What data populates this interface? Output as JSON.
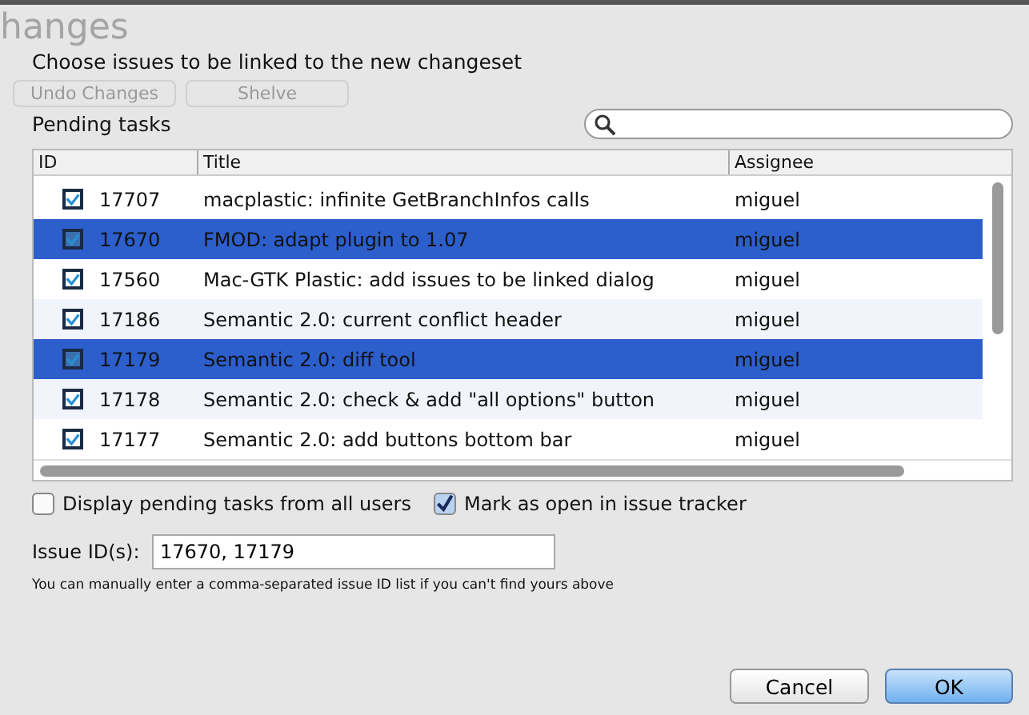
{
  "background": {
    "title": "hanges",
    "buttons": [
      "Undo Changes",
      "Shelve"
    ]
  },
  "dialog": {
    "heading": "Choose issues to be linked to the new changeset",
    "section_label": "Pending tasks"
  },
  "table": {
    "columns": [
      "ID",
      "Title",
      "Assignee"
    ],
    "rows": [
      {
        "id": "17707",
        "title": "macplastic: infinite GetBranchInfos calls",
        "assignee": "miguel",
        "checked": true,
        "selected": false
      },
      {
        "id": "17670",
        "title": "FMOD: adapt plugin to 1.07",
        "assignee": "miguel",
        "checked": true,
        "selected": true
      },
      {
        "id": "17560",
        "title": "Mac-GTK Plastic: add issues to be linked dialog",
        "assignee": "miguel",
        "checked": true,
        "selected": false
      },
      {
        "id": "17186",
        "title": "Semantic 2.0: current conflict header",
        "assignee": "miguel",
        "checked": true,
        "selected": false
      },
      {
        "id": "17179",
        "title": "Semantic 2.0: diff tool",
        "assignee": "miguel",
        "checked": true,
        "selected": true
      },
      {
        "id": "17178",
        "title": "Semantic 2.0: check & add \"all options\" button",
        "assignee": "miguel",
        "checked": true,
        "selected": false
      },
      {
        "id": "17177",
        "title": "Semantic 2.0: add buttons bottom bar",
        "assignee": "miguel",
        "checked": true,
        "selected": false
      }
    ]
  },
  "options": [
    {
      "label": "Display pending tasks from all users",
      "checked": false
    },
    {
      "label": "Mark as open in issue tracker",
      "checked": true
    }
  ],
  "issue_ids": {
    "label": "Issue ID(s):",
    "value": "17670, 17179",
    "hint": "You can manually enter a comma-separated issue ID list if you can't find yours above"
  },
  "buttons": [
    {
      "label": "Cancel",
      "kind": "secondary"
    },
    {
      "label": "OK",
      "kind": "primary"
    }
  ]
}
